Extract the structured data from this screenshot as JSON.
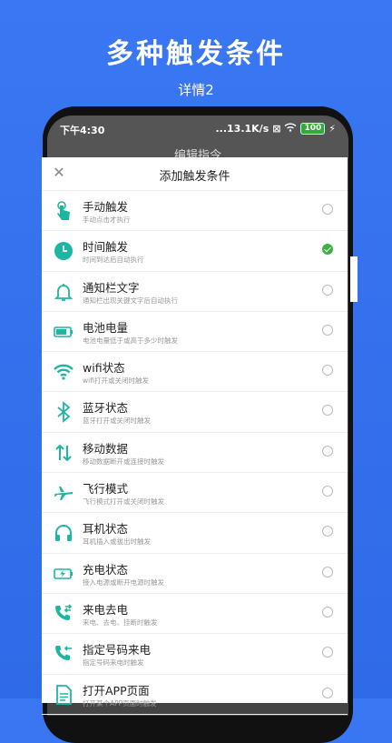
{
  "promo": {
    "title": "多种触发条件",
    "subtitle": "详情2"
  },
  "status_bar": {
    "time": "下午4:30",
    "speed": "...13.1K/s",
    "battery": "100"
  },
  "background_page_title": "编辑指令",
  "sheet": {
    "title": "添加触发条件",
    "items": [
      {
        "title": "手动触发",
        "desc": "手动点击才执行",
        "icon": "hand-tap-icon",
        "checked": false
      },
      {
        "title": "时间触发",
        "desc": "时间到达后自动执行",
        "icon": "clock-icon",
        "checked": true
      },
      {
        "title": "通知栏文字",
        "desc": "通知栏出现关键文字后自动执行",
        "icon": "bell-icon",
        "checked": false
      },
      {
        "title": "电池电量",
        "desc": "电池电量低于或高于多少时触发",
        "icon": "battery-icon",
        "checked": false
      },
      {
        "title": "wifi状态",
        "desc": "wifi打开或关闭时触发",
        "icon": "wifi-icon",
        "checked": false
      },
      {
        "title": "蓝牙状态",
        "desc": "蓝牙打开或关闭时触发",
        "icon": "bluetooth-icon",
        "checked": false
      },
      {
        "title": "移动数据",
        "desc": "移动数据断开或连接时触发",
        "icon": "data-arrows-icon",
        "checked": false
      },
      {
        "title": "飞行模式",
        "desc": "飞行模式打开或关闭时触发",
        "icon": "airplane-icon",
        "checked": false
      },
      {
        "title": "耳机状态",
        "desc": "耳机插入或拔出时触发",
        "icon": "headphones-icon",
        "checked": false
      },
      {
        "title": "充电状态",
        "desc": "接入电源或断开电源时触发",
        "icon": "charging-icon",
        "checked": false
      },
      {
        "title": "来电去电",
        "desc": "来电、去电、挂断时触发",
        "icon": "phone-calls-icon",
        "checked": false
      },
      {
        "title": "指定号码来电",
        "desc": "指定号码来电时触发",
        "icon": "incoming-call-icon",
        "checked": false
      },
      {
        "title": "打开APP页面",
        "desc": "打开某个APP页面时触发",
        "icon": "document-icon",
        "checked": false
      }
    ]
  },
  "colors": {
    "accent": "#1fb5a3",
    "check": "#3cb043",
    "background": "#3a77f2"
  }
}
